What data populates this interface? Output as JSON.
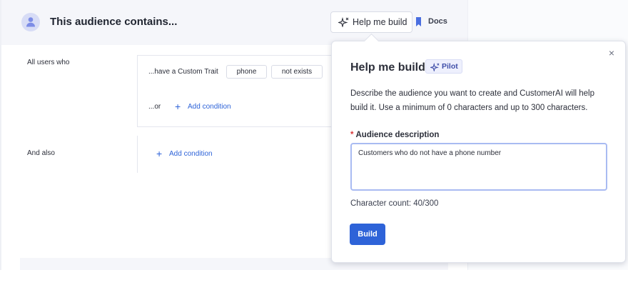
{
  "header": {
    "title": "This audience contains...",
    "help_button_label": "Help me build",
    "docs_label": "Docs"
  },
  "builder": {
    "rule1_label": "All users who",
    "condition": {
      "prefix": "...have a Custom Trait",
      "trait_value": "phone",
      "operator_value": "not exists"
    },
    "or_label": "...or",
    "add_condition_label": "Add condition",
    "rule2_label": "And also",
    "add_condition_label_2": "Add condition"
  },
  "popover": {
    "title": "Help me build",
    "badge": "Pilot",
    "description": "Describe the audience you want to create and CustomerAI will help build it. Use a minimum of 0 characters and up to 300 characters.",
    "field_required_mark": "*",
    "field_label": "Audience description",
    "field_value": "Customers who do not have a phone number",
    "character_count": "Character count: 40/300",
    "build_label": "Build",
    "close_symbol": "×"
  },
  "colors": {
    "accent": "#2e63d8",
    "required": "#d9383a",
    "badge_bg": "#eef0fd",
    "header_bg": "#f5f6fa"
  }
}
